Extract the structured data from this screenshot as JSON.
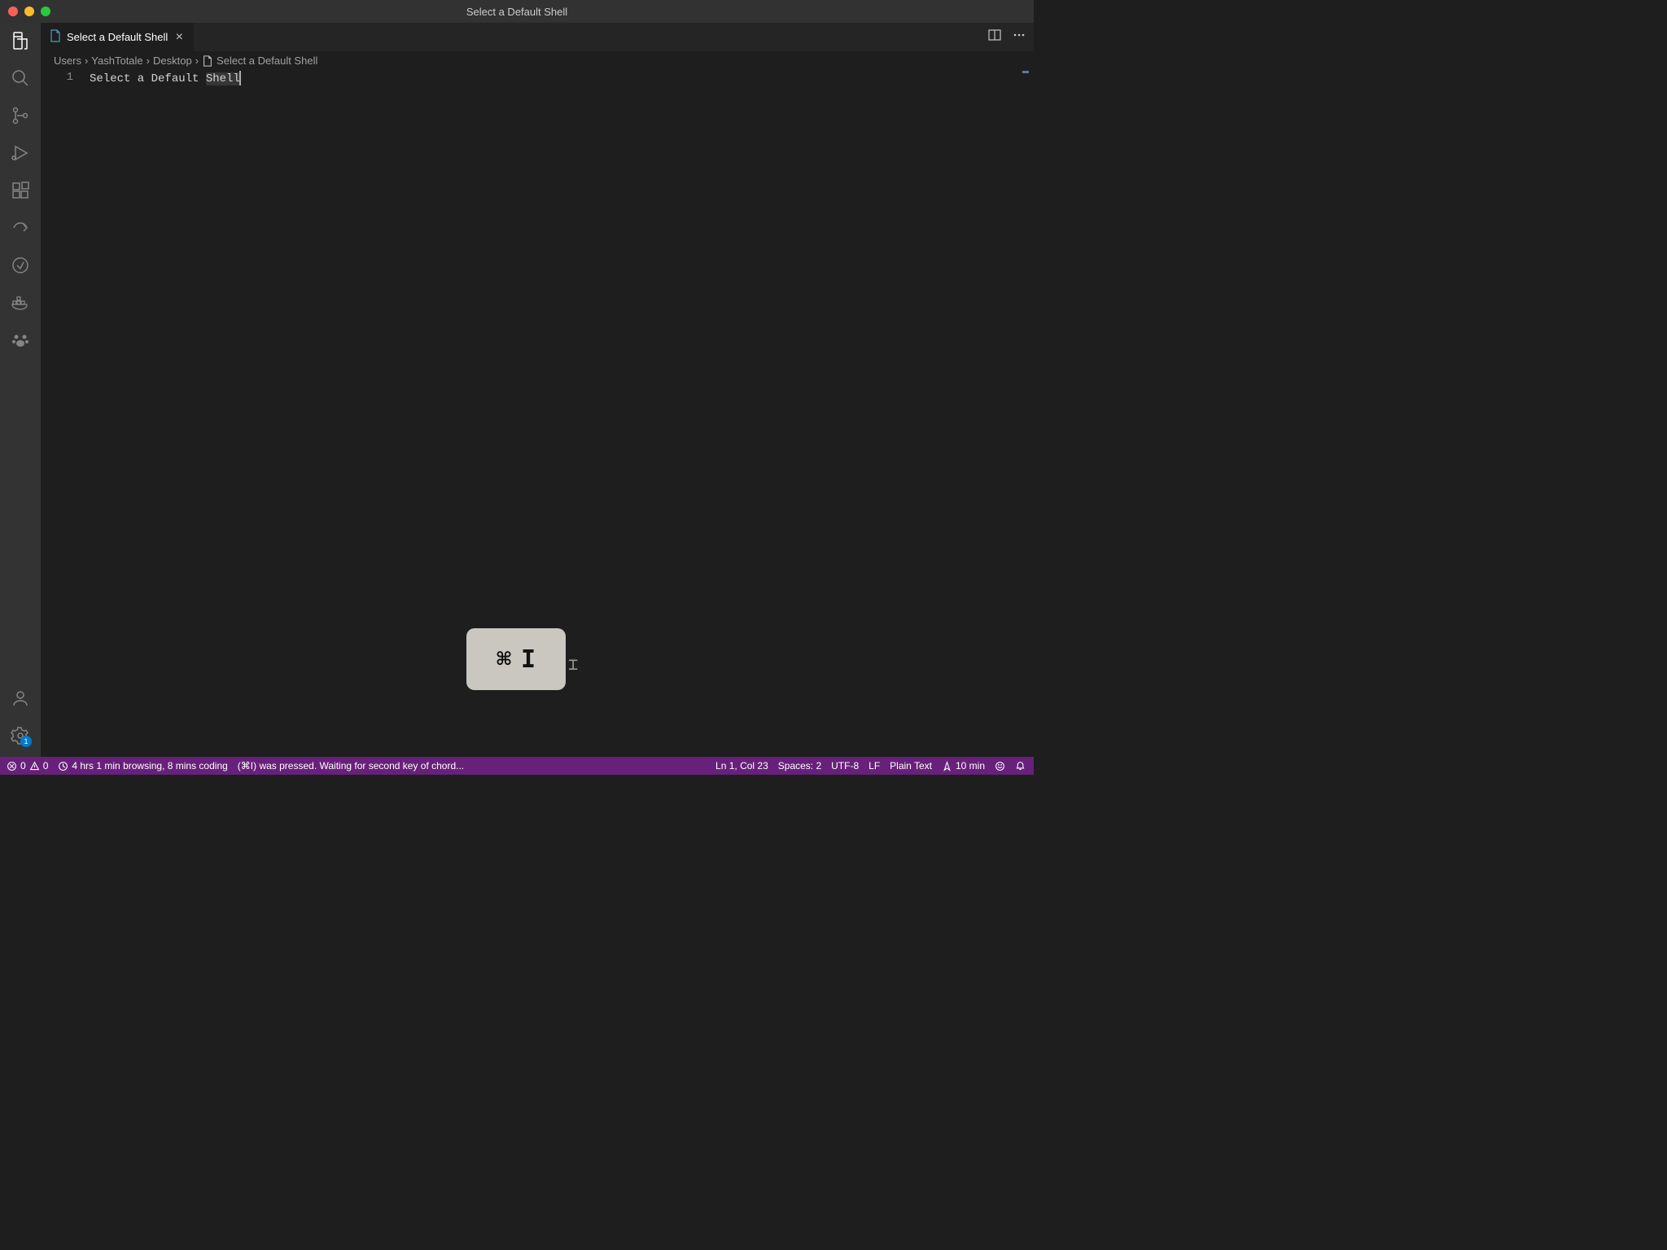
{
  "window": {
    "title": "Select a Default Shell"
  },
  "tab": {
    "label": "Select a Default Shell"
  },
  "breadcrumbs": {
    "segments": [
      "Users",
      "YashTotale",
      "Desktop"
    ],
    "file": "Select a Default Shell"
  },
  "editor": {
    "line_number": "1",
    "content_prefix": "Select a Default ",
    "content_highlight": "Shell"
  },
  "status": {
    "errors": "0",
    "warnings": "0",
    "time_tracker": "4 hrs 1 min browsing, 8 mins coding",
    "chord_message": "(⌘I) was pressed. Waiting for second key of chord...",
    "position": "Ln 1, Col 23",
    "spaces": "Spaces: 2",
    "encoding": "UTF-8",
    "eol": "LF",
    "language": "Plain Text",
    "session": "10 min"
  },
  "activity": {
    "settings_badge": "1"
  },
  "overlay": {
    "key1": "⌘",
    "key2": "I"
  }
}
